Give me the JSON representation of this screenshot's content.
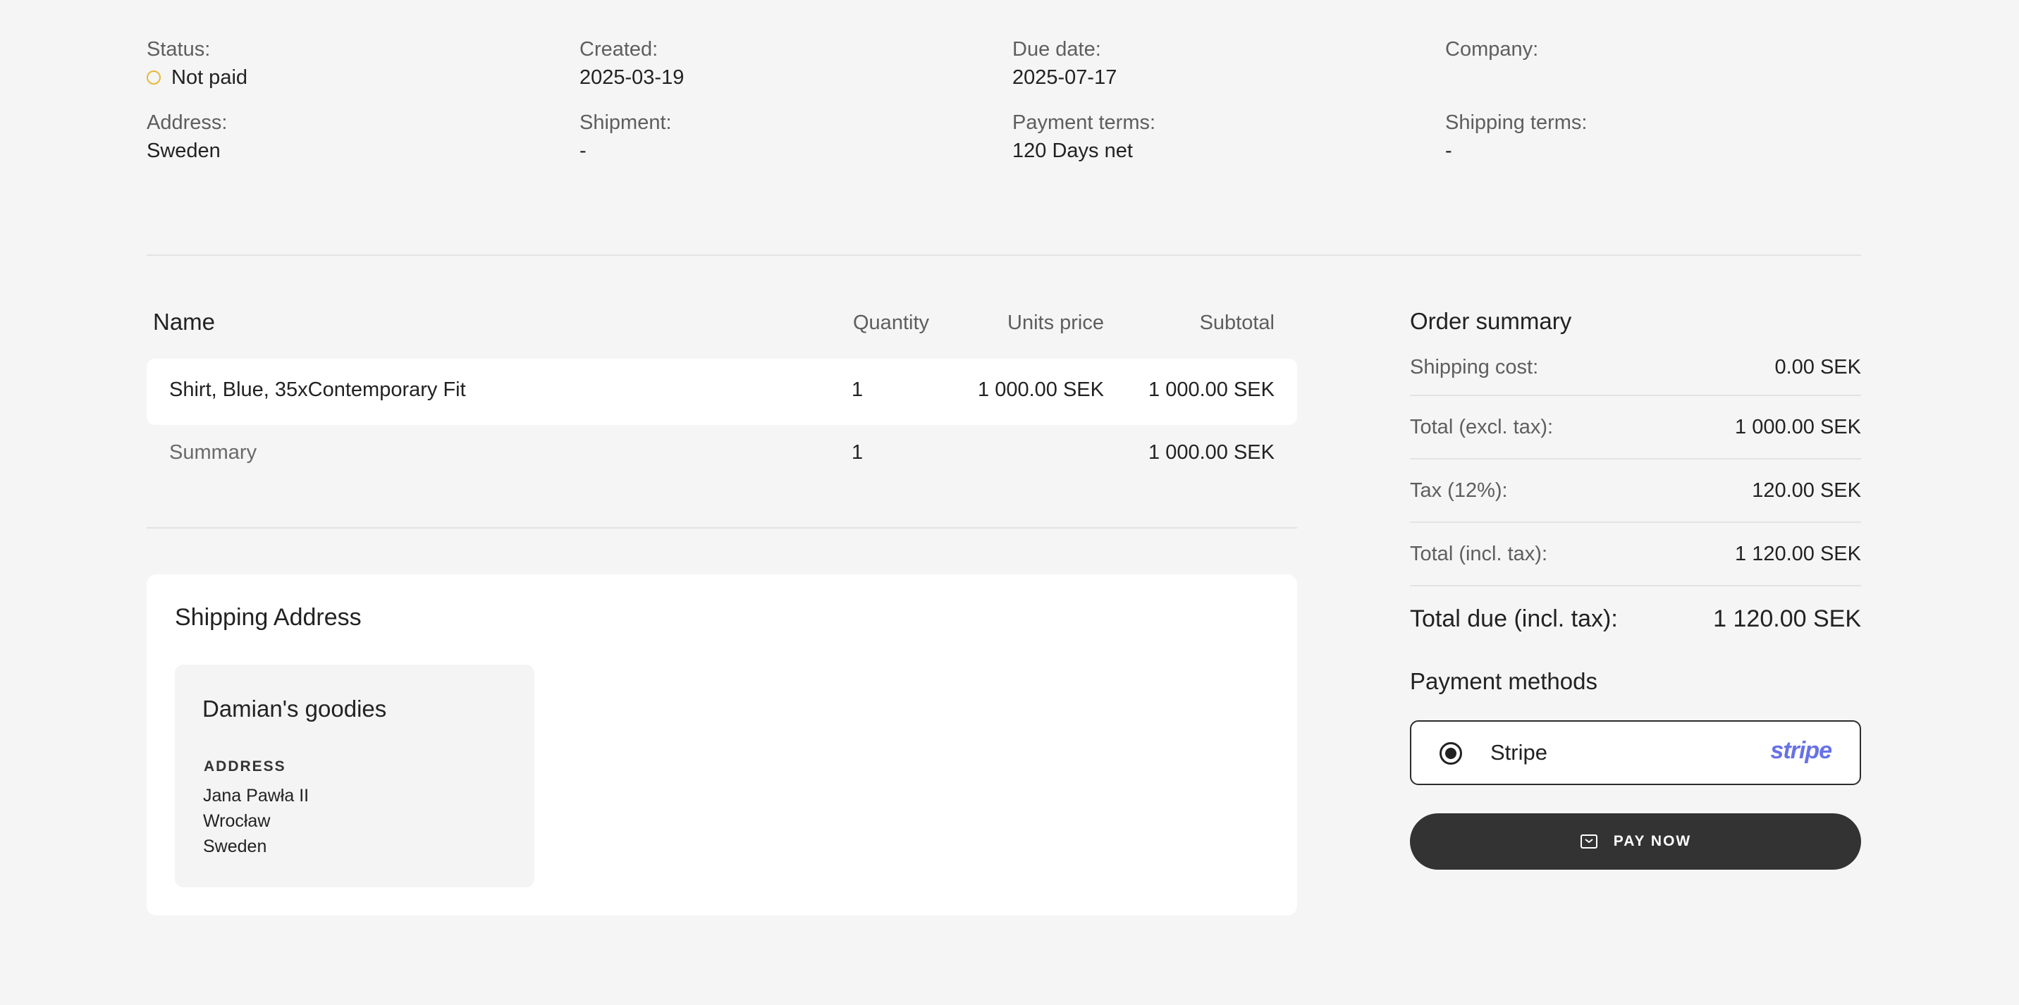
{
  "meta": {
    "status": {
      "label": "Status:",
      "value": "Not paid"
    },
    "created": {
      "label": "Created:",
      "value": "2025-03-19"
    },
    "due_date": {
      "label": "Due date:",
      "value": "2025-07-17"
    },
    "company": {
      "label": "Company:",
      "value": ""
    },
    "address": {
      "label": "Address:",
      "value": "Sweden"
    },
    "shipment": {
      "label": "Shipment:",
      "value": "-"
    },
    "payment_terms": {
      "label": "Payment terms:",
      "value": "120 Days net"
    },
    "shipping_terms": {
      "label": "Shipping terms:",
      "value": "-"
    }
  },
  "colors": {
    "status_not_paid": "#e6b93a",
    "stripe_brand": "#6772e5",
    "pay_button": "#333333"
  },
  "table": {
    "headers": {
      "name": "Name",
      "quantity": "Quantity",
      "units_price": "Units price",
      "subtotal": "Subtotal"
    },
    "rows": [
      {
        "name": "Shirt, Blue, 35xContemporary Fit",
        "quantity": "1",
        "units_price": "1 000.00 SEK",
        "subtotal": "1 000.00 SEK"
      }
    ],
    "summary": {
      "label": "Summary",
      "quantity": "1",
      "subtotal": "1 000.00 SEK"
    }
  },
  "shipping": {
    "title": "Shipping Address",
    "name": "Damian's goodies",
    "address_label": "ADDRESS",
    "lines": [
      "Jana Pawła II",
      "Wrocław",
      "Sweden"
    ]
  },
  "order_summary": {
    "title": "Order summary",
    "rows": [
      {
        "label": "Shipping cost:",
        "value": "0.00 SEK"
      },
      {
        "label": "Total (excl. tax):",
        "value": "1 000.00 SEK"
      },
      {
        "label": "Tax (12%):",
        "value": "120.00 SEK"
      },
      {
        "label": "Total (incl. tax):",
        "value": "1 120.00 SEK"
      }
    ],
    "total_due": {
      "label": "Total due (incl. tax):",
      "value": "1 120.00 SEK"
    }
  },
  "payment": {
    "title": "Payment methods",
    "method": "Stripe",
    "logo_text": "stripe",
    "selected": true,
    "pay_button": "PAY NOW",
    "pay_icon": "wallet-icon"
  }
}
